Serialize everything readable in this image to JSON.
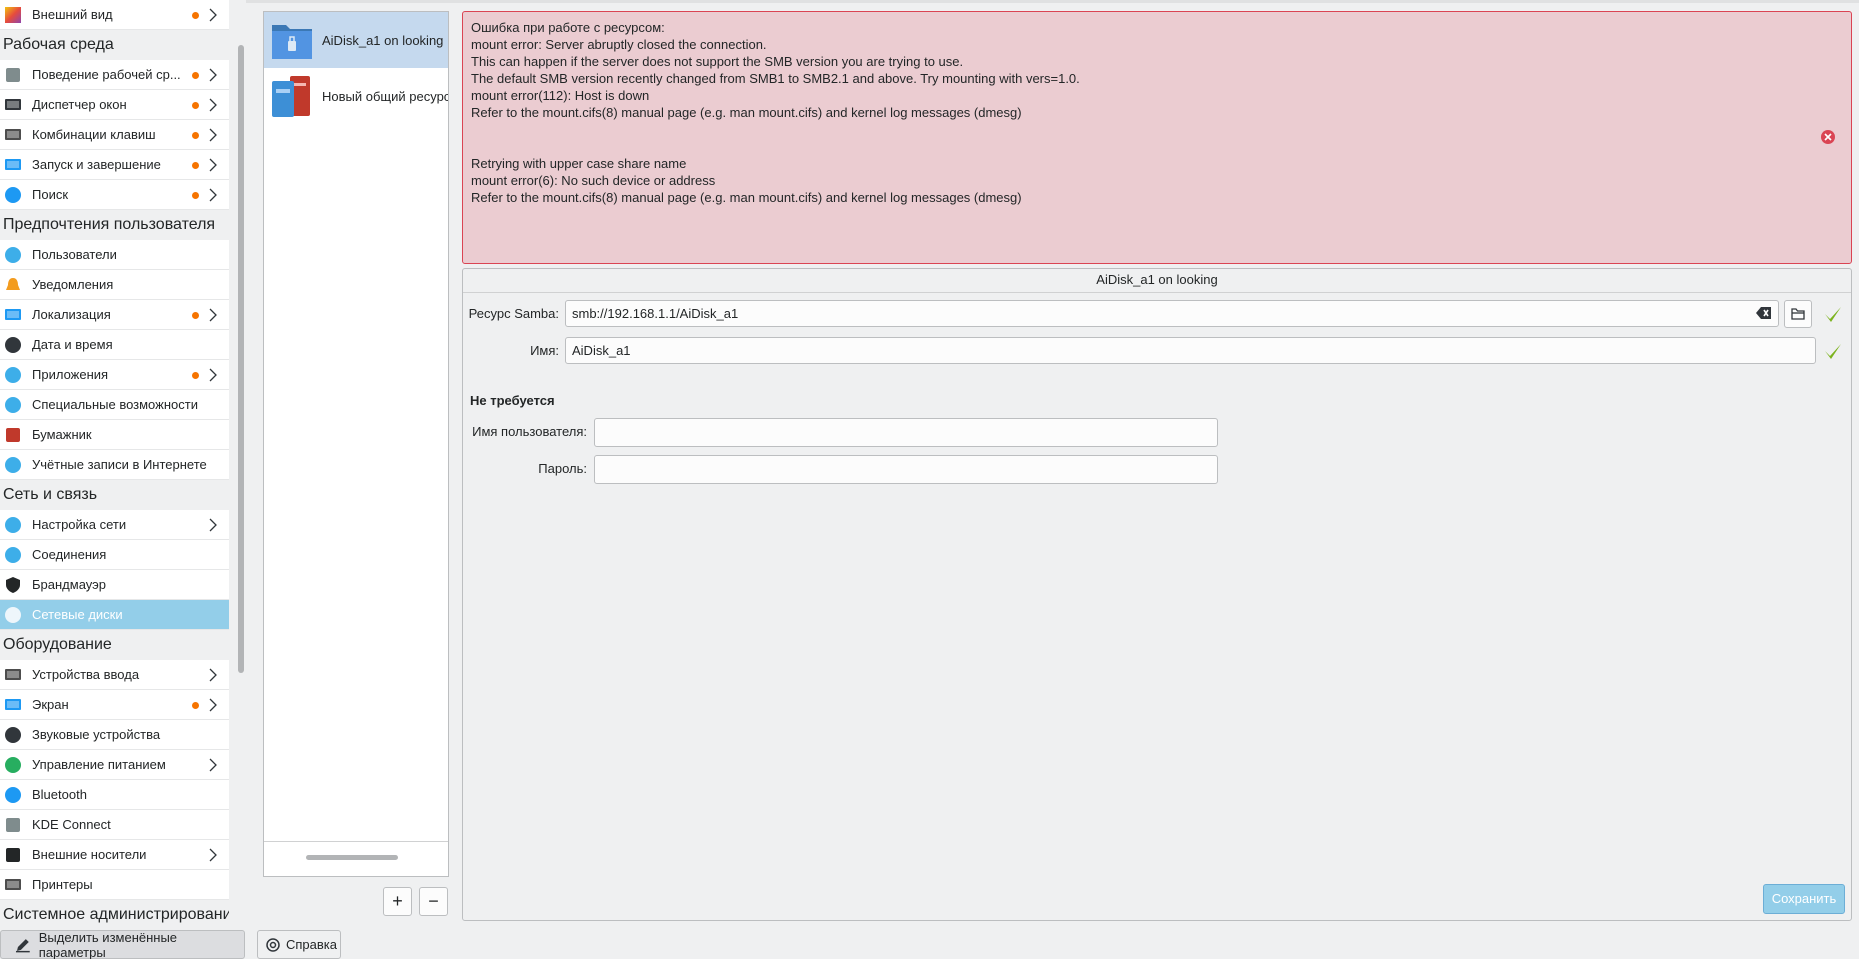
{
  "sidebar": {
    "first_item": {
      "label": "Внешний вид",
      "icon": "appearance-icon"
    },
    "sections": [
      {
        "title": "Рабочая среда",
        "items": [
          {
            "label": "Поведение рабочей ср...",
            "icon": "gear-icon",
            "dot": true,
            "chevron": true
          },
          {
            "label": "Диспетчер окон",
            "icon": "window-icon",
            "dot": true,
            "chevron": true
          },
          {
            "label": "Комбинации клавиш",
            "icon": "keyboard-icon",
            "dot": true,
            "chevron": true
          },
          {
            "label": "Запуск и завершение",
            "icon": "monitor-icon",
            "dot": true,
            "chevron": true
          },
          {
            "label": "Поиск",
            "icon": "search-icon",
            "dot": true,
            "chevron": true
          }
        ]
      },
      {
        "title": "Предпочтения пользователя",
        "items": [
          {
            "label": "Пользователи",
            "icon": "users-icon"
          },
          {
            "label": "Уведомления",
            "icon": "bell-icon"
          },
          {
            "label": "Локализация",
            "icon": "locale-icon",
            "dot": true,
            "chevron": true
          },
          {
            "label": "Дата и время",
            "icon": "clock-icon"
          },
          {
            "label": "Приложения",
            "icon": "apps-icon",
            "dot": true,
            "chevron": true
          },
          {
            "label": "Специальные возможности",
            "icon": "accessibility-icon"
          },
          {
            "label": "Бумажник",
            "icon": "wallet-icon"
          },
          {
            "label": "Учётные записи в Интернете",
            "icon": "globe-icon"
          }
        ]
      },
      {
        "title": "Сеть и связь",
        "items": [
          {
            "label": "Настройка сети",
            "icon": "globe-icon",
            "chevron": true
          },
          {
            "label": "Соединения",
            "icon": "globe-icon"
          },
          {
            "label": "Брандмауэр",
            "icon": "shield-icon"
          },
          {
            "label": "Сетевые диски",
            "icon": "share-icon",
            "active": true
          }
        ]
      },
      {
        "title": "Оборудование",
        "items": [
          {
            "label": "Устройства ввода",
            "icon": "keyboard-icon",
            "chevron": true
          },
          {
            "label": "Экран",
            "icon": "monitor-icon",
            "dot": true,
            "chevron": true
          },
          {
            "label": "Звуковые устройства",
            "icon": "speaker-icon"
          },
          {
            "label": "Управление питанием",
            "icon": "power-icon",
            "chevron": true
          },
          {
            "label": "Bluetooth",
            "icon": "bluetooth-icon"
          },
          {
            "label": "KDE Connect",
            "icon": "phone-icon"
          },
          {
            "label": "Внешние носители",
            "icon": "usb-icon",
            "chevron": true
          },
          {
            "label": "Принтеры",
            "icon": "printer-icon"
          }
        ]
      },
      {
        "title": "Системное администрировани",
        "items": []
      }
    ]
  },
  "bottom": {
    "highlight_label": "Выделить изменённые параметры",
    "help_label": "Справка"
  },
  "shares": {
    "items": [
      {
        "label": "AiDisk_a1 on looking",
        "active": true
      },
      {
        "label": "Новый общий ресурс"
      }
    ],
    "add_label": "+",
    "remove_label": "−"
  },
  "error": {
    "lines": [
      "Ошибка при работе с ресурсом:",
      "mount error: Server abruptly closed the connection.",
      "This can happen if the server does not support the SMB version you are trying to use.",
      "The default SMB version recently changed from SMB1 to SMB2.1 and above. Try mounting with vers=1.0.",
      "mount error(112): Host is down",
      "Refer to the mount.cifs(8) manual page (e.g. man mount.cifs) and kernel log messages (dmesg)",
      "",
      "",
      "Retrying with upper case share name",
      "mount error(6): No such device or address",
      "Refer to the mount.cifs(8) manual page (e.g. man mount.cifs) and kernel log messages (dmesg)"
    ]
  },
  "panel": {
    "title": "AiDisk_a1 on looking",
    "samba_label": "Ресурс Samba:",
    "samba_value": "smb://192.168.1.1/AiDisk_a1",
    "name_label": "Имя:",
    "name_value": "AiDisk_a1",
    "auth_heading": "Не требуется",
    "username_label": "Имя пользователя:",
    "username_value": "",
    "password_label": "Пароль:",
    "password_value": "",
    "save_label": "Сохранить"
  },
  "colors": {
    "accent": "#93cee9",
    "error_bg": "#ebccd1",
    "error_border": "#da4453",
    "modified_dot": "#f67400",
    "check_green": "#7cb31f"
  }
}
